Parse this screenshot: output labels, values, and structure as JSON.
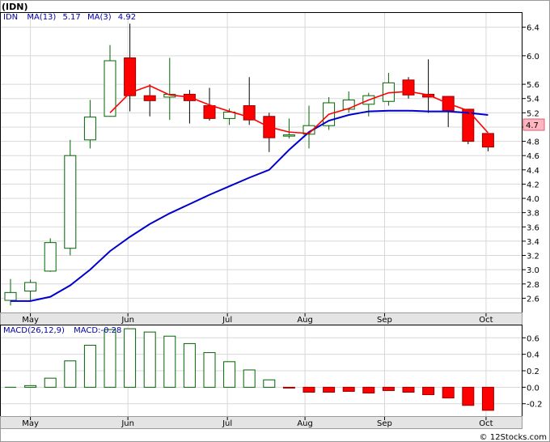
{
  "chart_data": [
    {
      "type": "candlestick",
      "title": "(IDN)",
      "legend": {
        "symbol": "IDN",
        "ma13_label": "MA(13)",
        "ma13_value": "5.17",
        "ma3_label": "MA(3)",
        "ma3_value": "4.92"
      },
      "last_price_label": "4.7",
      "ylim": [
        2.4,
        6.6
      ],
      "yticks": [
        2.6,
        2.8,
        3.0,
        3.2,
        3.4,
        3.6,
        3.8,
        4.0,
        4.2,
        4.4,
        4.6,
        4.8,
        5.0,
        5.2,
        5.4,
        5.6,
        6.0,
        6.4
      ],
      "ytick_labels": [
        "2.6",
        "2.8",
        "3.0",
        "3.2",
        "3.4",
        "3.6",
        "3.8",
        "4.0",
        "4.2",
        "4.4",
        "4.6",
        "4.8",
        "5.0",
        "5.2",
        "5.4",
        "5.6",
        "6.0",
        "6.4"
      ],
      "months": [
        "May",
        "Jun",
        "Jul",
        "Aug",
        "Sep",
        "Oct"
      ],
      "candles": [
        {
          "o": 2.57,
          "h": 2.87,
          "l": 2.5,
          "c": 2.68
        },
        {
          "o": 2.7,
          "h": 2.86,
          "l": 2.55,
          "c": 2.82
        },
        {
          "o": 2.98,
          "h": 3.44,
          "l": 2.97,
          "c": 3.38
        },
        {
          "o": 3.3,
          "h": 4.82,
          "l": 3.2,
          "c": 4.6
        },
        {
          "o": 4.82,
          "h": 5.38,
          "l": 4.7,
          "c": 5.14
        },
        {
          "o": 5.15,
          "h": 6.15,
          "l": 5.15,
          "c": 5.93
        },
        {
          "o": 5.97,
          "h": 6.45,
          "l": 5.22,
          "c": 5.44
        },
        {
          "o": 5.44,
          "h": 5.6,
          "l": 5.15,
          "c": 5.37
        },
        {
          "o": 5.42,
          "h": 5.97,
          "l": 5.1,
          "c": 5.46
        },
        {
          "o": 5.46,
          "h": 5.52,
          "l": 5.05,
          "c": 5.37
        },
        {
          "o": 5.3,
          "h": 5.55,
          "l": 5.09,
          "c": 5.12
        },
        {
          "o": 5.12,
          "h": 5.26,
          "l": 5.03,
          "c": 5.21
        },
        {
          "o": 5.3,
          "h": 5.7,
          "l": 5.03,
          "c": 5.1
        },
        {
          "o": 5.15,
          "h": 5.2,
          "l": 4.65,
          "c": 4.85
        },
        {
          "o": 4.89,
          "h": 5.12,
          "l": 4.84,
          "c": 4.89
        },
        {
          "o": 4.9,
          "h": 5.3,
          "l": 4.7,
          "c": 5.02
        },
        {
          "o": 5.02,
          "h": 5.42,
          "l": 4.96,
          "c": 5.34
        },
        {
          "o": 5.25,
          "h": 5.5,
          "l": 5.2,
          "c": 5.38
        },
        {
          "o": 5.32,
          "h": 5.48,
          "l": 5.15,
          "c": 5.44
        },
        {
          "o": 5.36,
          "h": 5.76,
          "l": 5.3,
          "c": 5.62
        },
        {
          "o": 5.66,
          "h": 5.7,
          "l": 5.4,
          "c": 5.45
        },
        {
          "o": 5.46,
          "h": 5.95,
          "l": 5.2,
          "c": 5.42
        },
        {
          "o": 5.43,
          "h": 5.43,
          "l": 5.0,
          "c": 5.23
        },
        {
          "o": 5.25,
          "h": 5.25,
          "l": 4.76,
          "c": 4.8
        },
        {
          "o": 4.91,
          "h": 4.91,
          "l": 4.66,
          "c": 4.72
        }
      ],
      "ma13": [
        2.56,
        2.56,
        2.62,
        2.78,
        3.0,
        3.26,
        3.46,
        3.64,
        3.79,
        3.92,
        4.05,
        4.17,
        4.29,
        4.4,
        4.68,
        4.93,
        5.09,
        5.17,
        5.22,
        5.23,
        5.23,
        5.22,
        5.22,
        5.2,
        5.17
      ],
      "ma3": [
        null,
        null,
        null,
        null,
        null,
        5.2,
        5.48,
        5.58,
        5.45,
        5.42,
        5.31,
        5.22,
        5.14,
        5.0,
        4.93,
        4.91,
        5.18,
        5.26,
        5.38,
        5.48,
        5.5,
        5.45,
        5.33,
        5.23,
        4.92
      ],
      "month_start_index": [
        1,
        5.9,
        10.9,
        14.8,
        18.8,
        23.9
      ]
    },
    {
      "type": "bar",
      "legend": {
        "label": "MACD(26,12,9)",
        "value_label": "MACD:-0.28"
      },
      "ylim": [
        -0.35,
        0.75
      ],
      "yticks": [
        -0.2,
        0.0,
        0.2,
        0.4,
        0.6
      ],
      "ytick_labels": [
        "-0.2",
        "0.0",
        "0.2",
        "0.4",
        "0.6"
      ],
      "values": [
        0.0,
        0.02,
        0.11,
        0.32,
        0.51,
        0.7,
        0.71,
        0.67,
        0.62,
        0.53,
        0.42,
        0.31,
        0.21,
        0.09,
        -0.01,
        -0.06,
        -0.06,
        -0.05,
        -0.07,
        -0.04,
        -0.06,
        -0.09,
        -0.13,
        -0.22,
        -0.28
      ],
      "positive_color": "#006400",
      "negative_color": "#ff0000"
    }
  ],
  "colors": {
    "up_candle_border": "#006400",
    "down_candle_fill": "#ff0000",
    "ma13": "#0000cc",
    "ma3": "#ff0000",
    "legend_text": "#0000aa",
    "last_price_bg": "#ffb6c1"
  },
  "watermark": "© 12Stocks.com"
}
